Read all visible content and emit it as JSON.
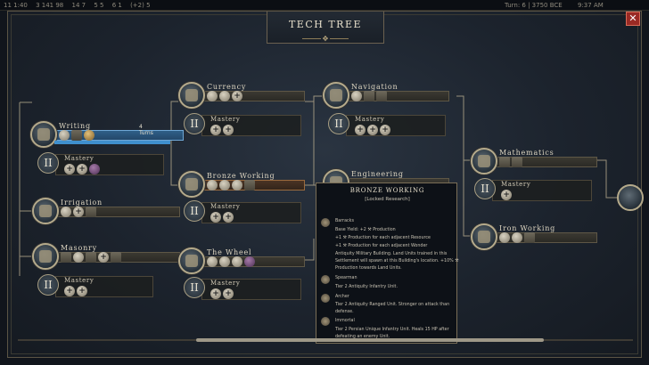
{
  "topbar": {
    "resources": [
      "11 1:40",
      "3 141 98",
      "14 7",
      "5 5",
      "6 1",
      "(+2) 5"
    ],
    "turn": "Turn: 6 | 3750 BCE",
    "time": "9:37 AM"
  },
  "title": "TECH TREE",
  "close_label": "✕",
  "nodes": [
    {
      "name": "Writing",
      "turns": "4 Turns",
      "icons": [
        "circle",
        "sq",
        "gold"
      ]
    },
    {
      "name": "Irrigation",
      "icons": [
        "circle",
        "plus",
        "sq"
      ]
    },
    {
      "name": "Masonry",
      "icons": [
        "sq",
        "circle",
        "sq",
        "plus",
        "sq"
      ]
    },
    {
      "name": "Currency",
      "icons": [
        "circle",
        "circle",
        "plus"
      ]
    },
    {
      "name": "Bronze Working",
      "icons": [
        "circle",
        "circle",
        "circle",
        "sq"
      ]
    },
    {
      "name": "The Wheel",
      "icons": [
        "circle",
        "circle",
        "circle",
        "pur"
      ]
    },
    {
      "name": "Navigation",
      "icons": [
        "circle",
        "sq",
        "sq"
      ]
    },
    {
      "name": "Engineering",
      "icons": []
    },
    {
      "name": "Mathematics",
      "icons": [
        "sq",
        "sq"
      ]
    },
    {
      "name": "Iron Working",
      "icons": [
        "circle",
        "circle",
        "sq"
      ]
    }
  ],
  "mastery": {
    "label": "Mastery",
    "numeral": "II"
  },
  "mastery_icons": {
    "writing": [
      "plus",
      "plus",
      "pur"
    ],
    "irrigation": [],
    "masonry": [
      "plus",
      "plus"
    ],
    "currency": [
      "plus",
      "plus"
    ],
    "bronze": [
      "plus",
      "plus"
    ],
    "wheel": [
      "plus",
      "plus"
    ],
    "navigation": [
      "plus",
      "plus",
      "plus"
    ],
    "mathematics": [
      "plus"
    ]
  },
  "tooltip": {
    "title": "BRONZE WORKING",
    "subtitle": "[Locked Research]",
    "lines": [
      "Barracks",
      "Base Yield: +2 ⚒ Production",
      "+1 ⚒ Production for each adjacent Resource",
      "+1 ⚒ Production for each adjacent Wonder",
      "Antiquity Military Building. Land Units trained in this",
      "Settlement will spawn at this Building's location. +10% ⚒",
      "Production towards Land Units.",
      "Spearman",
      "Tier 2 Antiquity Infantry Unit.",
      "Archer",
      "Tier 2 Antiquity Ranged Unit. Stronger on attack than",
      "defense.",
      "Immortal",
      "Tier 2 Persian Unique Infantry Unit. Heals 15 HP after",
      "defeating an enemy Unit."
    ]
  },
  "progress": {
    "writing": 0.9
  }
}
